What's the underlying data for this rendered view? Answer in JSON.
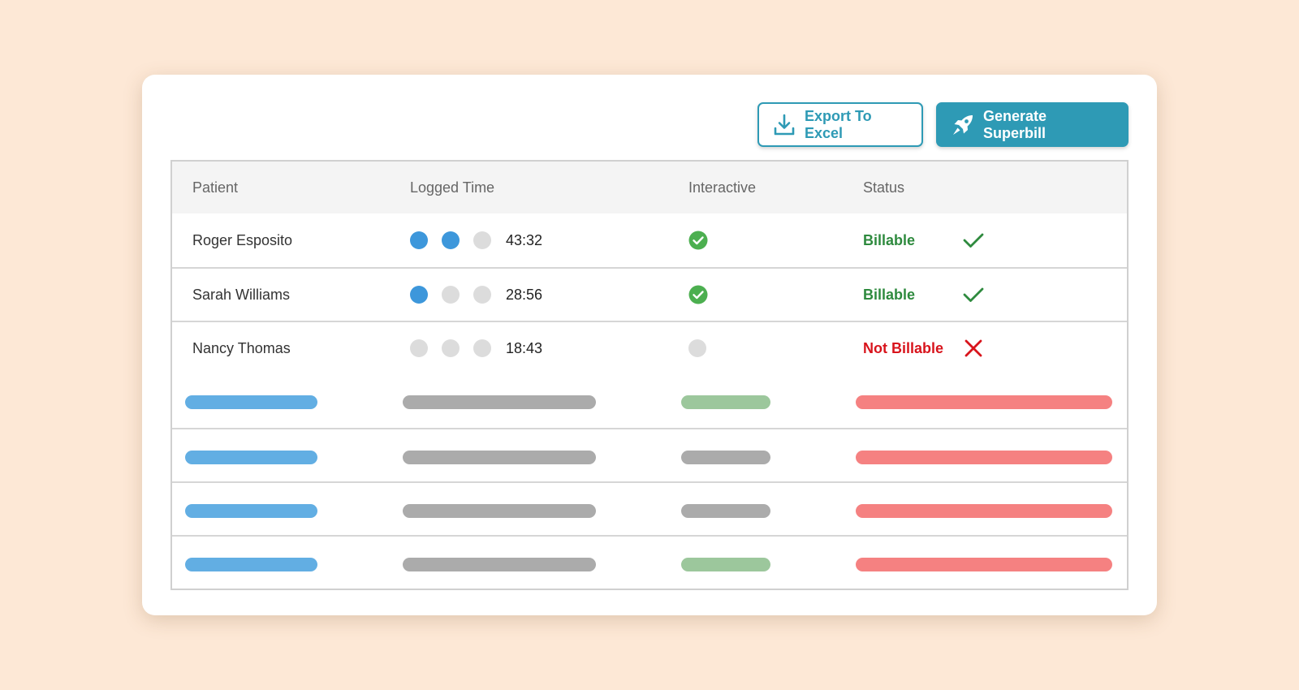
{
  "toolbar": {
    "export_label": "Export To Excel",
    "superbill_label": "Generate Superbill",
    "accent_color": "#2e9ab5"
  },
  "table": {
    "headers": {
      "patient": "Patient",
      "logged_time": "Logged Time",
      "interactive": "Interactive",
      "status": "Status"
    },
    "rows": [
      {
        "patient": "Roger Esposito",
        "time_level": 2,
        "time": "43:32",
        "interactive": true,
        "status": "Billable",
        "status_icon": "check-icon"
      },
      {
        "patient": "Sarah Williams",
        "time_level": 1,
        "time": "28:56",
        "interactive": true,
        "status": "Billable",
        "status_icon": "check-icon"
      },
      {
        "patient": "Nancy Thomas",
        "time_level": 0,
        "time": "18:43",
        "interactive": false,
        "status": "Not Billable",
        "status_icon": "x-icon"
      }
    ],
    "placeholder_rows": [
      {
        "interactive_color": "green"
      },
      {
        "interactive_color": "gray"
      },
      {
        "interactive_color": "gray"
      },
      {
        "interactive_color": "green"
      }
    ]
  },
  "colors": {
    "background": "#fde8d6",
    "dot_active": "#3d97db",
    "dot_inactive": "#dcdcdc",
    "interactive_ok": "#4caf50",
    "billable": "#2e8a3e",
    "not_billable": "#d8141c",
    "placeholder_blue": "#62aee3",
    "placeholder_gray": "#ababab",
    "placeholder_green": "#9cc79c",
    "placeholder_red": "#f58181"
  }
}
